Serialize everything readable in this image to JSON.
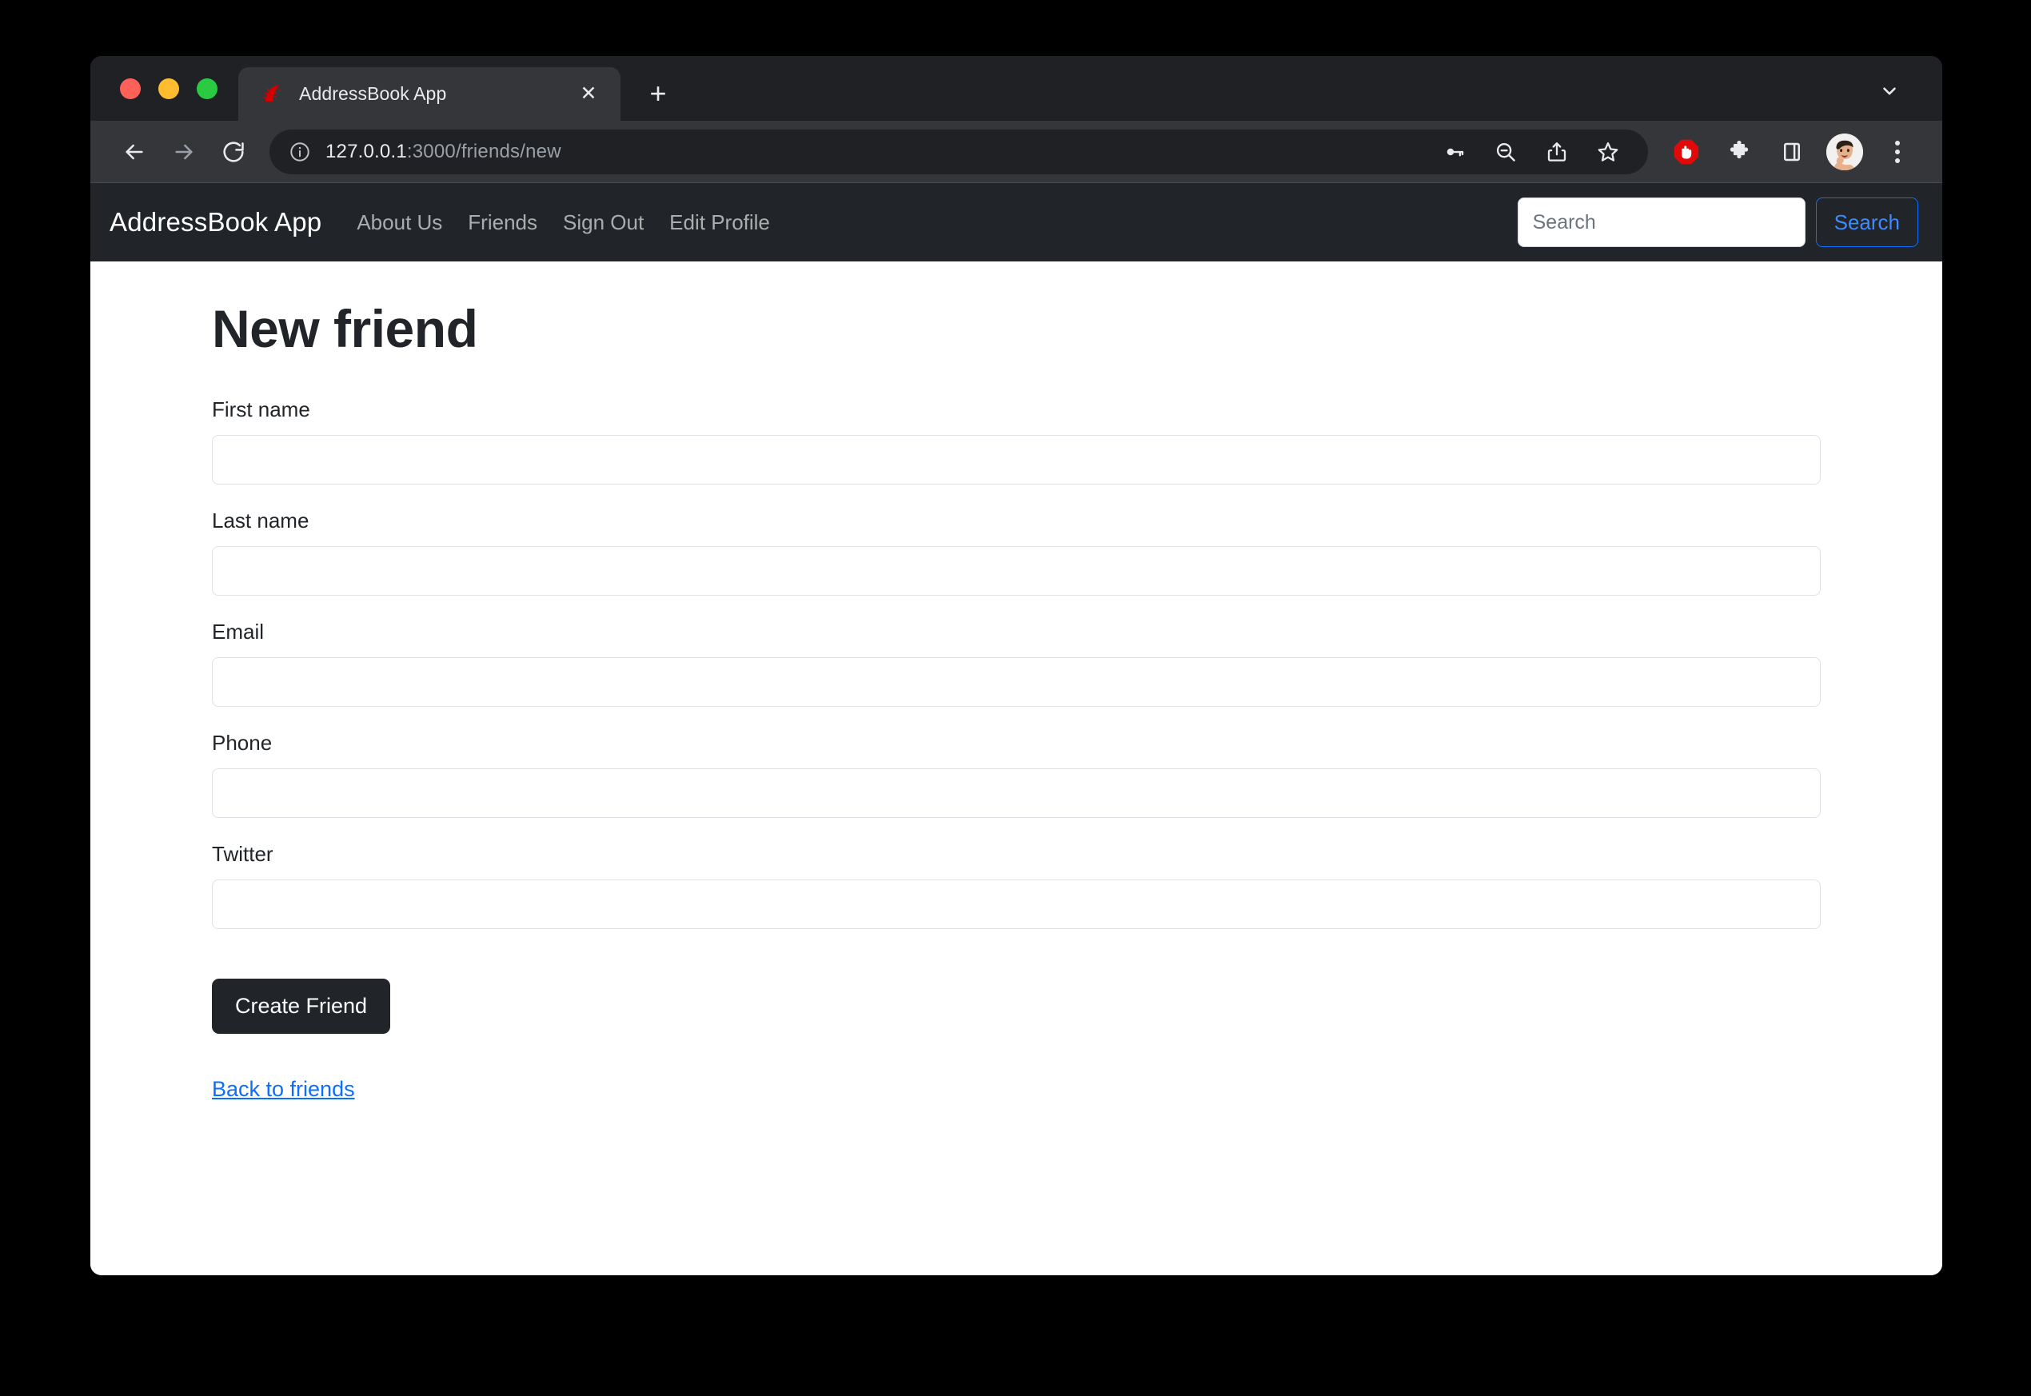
{
  "browser": {
    "tab": {
      "title": "AddressBook App",
      "favicon_name": "rails-favicon",
      "close_label": "✕"
    },
    "new_tab_label": "+",
    "toolbar": {
      "back_label": "back-arrow",
      "forward_label": "forward-arrow",
      "reload_label": "reload",
      "url_primary": "127.0.0.1",
      "url_secondary": ":3000/friends/new",
      "site_info_icon": "info-circle-icon",
      "icons": [
        "password-key-icon",
        "zoom-out-icon",
        "share-icon",
        "bookmark-star-icon",
        "adblock-icon",
        "extensions-puzzle-icon",
        "side-panel-icon",
        "profile-avatar-icon",
        "chrome-menu-kebab-icon"
      ]
    }
  },
  "app": {
    "brand": "AddressBook App",
    "nav_links": [
      {
        "label": "About Us"
      },
      {
        "label": "Friends"
      },
      {
        "label": "Sign Out"
      },
      {
        "label": "Edit Profile"
      }
    ],
    "search": {
      "placeholder": "Search",
      "value": "",
      "button_label": "Search"
    }
  },
  "page": {
    "title": "New friend",
    "fields": [
      {
        "label": "First name",
        "value": "",
        "name": "first-name"
      },
      {
        "label": "Last name",
        "value": "",
        "name": "last-name"
      },
      {
        "label": "Email",
        "value": "",
        "name": "email"
      },
      {
        "label": "Phone",
        "value": "",
        "name": "phone"
      },
      {
        "label": "Twitter",
        "value": "",
        "name": "twitter"
      }
    ],
    "submit_label": "Create Friend",
    "back_link_label": "Back to friends"
  },
  "colors": {
    "accent_blue": "#0D6EFD",
    "link_blue": "#0D6EFD",
    "navbar_dark": "#212529",
    "button_dark": "#212529",
    "browser_chrome": "#202124",
    "tab_active": "#35363A",
    "page_background": "#FFFFFF",
    "desktop_background": "#000000"
  }
}
